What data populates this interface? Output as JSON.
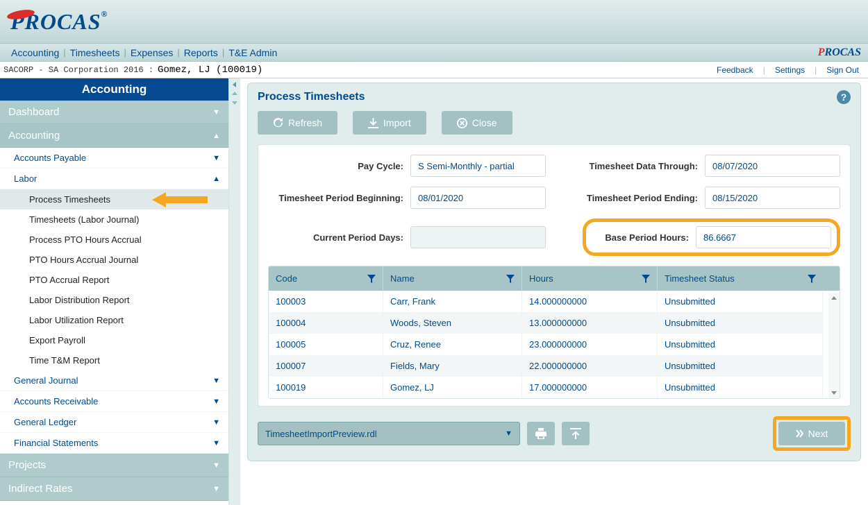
{
  "logo": "PROCAS",
  "top_nav": {
    "accounting": "Accounting",
    "timesheets": "Timesheets",
    "expenses": "Expenses",
    "reports": "Reports",
    "te_admin": "T&E Admin"
  },
  "info_bar": {
    "company": "SACORP - SA Corporation 2016 :",
    "user": "Gomez, LJ (100019)",
    "feedback": "Feedback",
    "settings": "Settings",
    "signout": "Sign Out"
  },
  "sidebar": {
    "title": "Accounting",
    "dashboard": "Dashboard",
    "accounting": "Accounting",
    "accounts_payable": "Accounts Payable",
    "labor": "Labor",
    "labor_items": {
      "process_timesheets": "Process Timesheets",
      "timesheets_journal": "Timesheets (Labor Journal)",
      "process_pto": "Process PTO Hours Accrual",
      "pto_journal": "PTO Hours Accrual Journal",
      "pto_report": "PTO Accrual Report",
      "labor_dist": "Labor Distribution Report",
      "labor_util": "Labor Utilization Report",
      "export_payroll": "Export Payroll",
      "time_tm": "Time T&M Report"
    },
    "general_journal": "General Journal",
    "accounts_receivable": "Accounts Receivable",
    "general_ledger": "General Ledger",
    "financial_statements": "Financial Statements",
    "projects": "Projects",
    "indirect_rates": "Indirect Rates"
  },
  "panel": {
    "title": "Process Timesheets",
    "refresh": "Refresh",
    "import": "Import",
    "close": "Close",
    "labels": {
      "pay_cycle": "Pay Cycle:",
      "period_begin": "Timesheet Period Beginning:",
      "current_days": "Current Period Days:",
      "data_through": "Timesheet Data Through:",
      "period_end": "Timesheet Period Ending:",
      "base_hours": "Base Period Hours:"
    },
    "values": {
      "pay_cycle": "S Semi-Monthly - partial",
      "period_begin": "08/01/2020",
      "current_days": "",
      "data_through": "08/07/2020",
      "period_end": "08/15/2020",
      "base_hours": "86.6667"
    },
    "grid": {
      "headers": {
        "code": "Code",
        "name": "Name",
        "hours": "Hours",
        "status": "Timesheet Status"
      },
      "rows": [
        {
          "code": "100003",
          "name": "Carr, Frank",
          "hours": "14.000000000",
          "status": "Unsubmitted"
        },
        {
          "code": "100004",
          "name": "Woods, Steven",
          "hours": "13.000000000",
          "status": "Unsubmitted"
        },
        {
          "code": "100005",
          "name": "Cruz, Renee",
          "hours": "23.000000000",
          "status": "Unsubmitted"
        },
        {
          "code": "100007",
          "name": "Fields, Mary",
          "hours": "22.000000000",
          "status": "Unsubmitted"
        },
        {
          "code": "100019",
          "name": "Gomez, LJ",
          "hours": "17.000000000",
          "status": "Unsubmitted"
        }
      ]
    },
    "report_select": "TimesheetImportPreview.rdl",
    "next": "Next"
  }
}
